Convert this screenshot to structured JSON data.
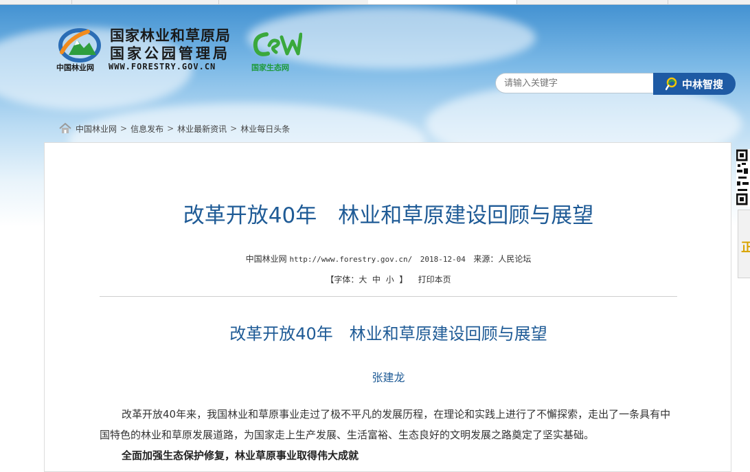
{
  "header": {
    "org_name_1": "国家林业和草原局",
    "org_name_2": "国家公园管理局",
    "site_short": "中国林业网",
    "site_url": "WWW.FORESTRY.GOV.CN",
    "eco_net_label": "国家生态网"
  },
  "search": {
    "placeholder": "请输入关键字",
    "button_label": "中林智搜"
  },
  "breadcrumb": {
    "items": [
      "中国林业网",
      "信息发布",
      "林业最新资讯",
      "林业每日头条"
    ],
    "separator": ">"
  },
  "article": {
    "title": "改革开放40年　林业和草原建设回顾与展望",
    "meta_site": "中国林业网",
    "meta_url": "http://www.forestry.gov.cn/",
    "meta_date": "2018-12-04",
    "meta_source": "来源：人民论坛",
    "font_label": "【字体：",
    "font_large": "大",
    "font_medium": "中",
    "font_small": "小",
    "font_close": "】",
    "print_label": "打印本页",
    "subtitle": "改革开放40年　林业和草原建设回顾与展望",
    "author": "张建龙",
    "paragraph_1": "改革开放40年来，我国林业和草原事业走过了极不平凡的发展历程，在理论和实践上进行了不懈探索，走出了一条具有中国特色的林业和草原发展道路，为国家走上生产发展、生活富裕、生态良好的文明发展之路奠定了坚实基础。",
    "section_heading": "全面加强生态保护修复，林业草原事业取得伟大成就"
  },
  "side": {
    "tab_char": "正"
  },
  "colors": {
    "title_blue": "#1f5b96",
    "search_button": "#1e5aa4",
    "eco_green": "#1e9a3c"
  }
}
